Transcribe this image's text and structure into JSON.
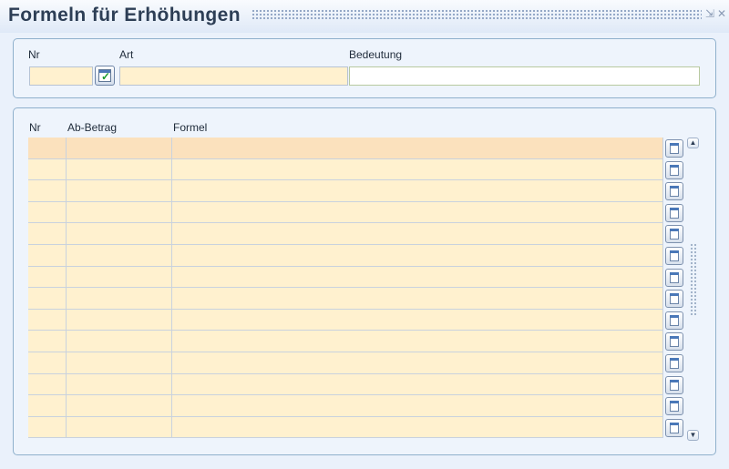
{
  "window": {
    "title": "Formeln für Erhöhungen",
    "controls": {
      "minimize_icon": "minimize-icon",
      "close_icon": "close-icon"
    }
  },
  "header_panel": {
    "nr_label": "Nr",
    "art_label": "Art",
    "bedeutung_label": "Bedeutung",
    "nr_value": "",
    "art_value": "",
    "bedeutung_value": "",
    "picker_icon": "calendar-check-icon"
  },
  "table": {
    "columns": [
      "Nr",
      "Ab-Betrag",
      "Formel"
    ],
    "rows": [
      {
        "nr": "",
        "ab_betrag": "",
        "formel": ""
      },
      {
        "nr": "",
        "ab_betrag": "",
        "formel": ""
      },
      {
        "nr": "",
        "ab_betrag": "",
        "formel": ""
      },
      {
        "nr": "",
        "ab_betrag": "",
        "formel": ""
      },
      {
        "nr": "",
        "ab_betrag": "",
        "formel": ""
      },
      {
        "nr": "",
        "ab_betrag": "",
        "formel": ""
      },
      {
        "nr": "",
        "ab_betrag": "",
        "formel": ""
      },
      {
        "nr": "",
        "ab_betrag": "",
        "formel": ""
      },
      {
        "nr": "",
        "ab_betrag": "",
        "formel": ""
      },
      {
        "nr": "",
        "ab_betrag": "",
        "formel": ""
      },
      {
        "nr": "",
        "ab_betrag": "",
        "formel": ""
      },
      {
        "nr": "",
        "ab_betrag": "",
        "formel": ""
      },
      {
        "nr": "",
        "ab_betrag": "",
        "formel": ""
      },
      {
        "nr": "",
        "ab_betrag": "",
        "formel": ""
      }
    ],
    "row_button_icon": "calendar-icon",
    "selected_row": 0
  },
  "colors": {
    "field_bg": "#fff1cf",
    "selected_row_bg": "#fbe1bd",
    "panel_border": "#8fb0cc",
    "title_text": "#2d3e55"
  }
}
